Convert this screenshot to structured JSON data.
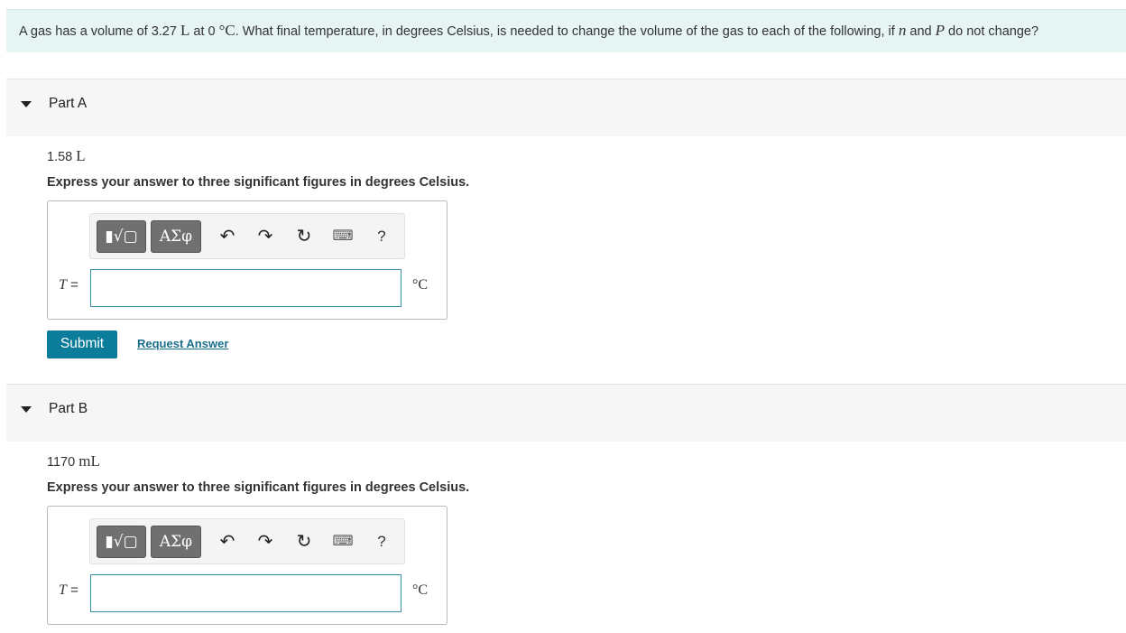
{
  "problem": {
    "text_1": "A gas has a volume of 3.27",
    "unit_1": "L",
    "text_2": "at 0",
    "unit_2": "°C",
    "text_3": ". What final temperature, in degrees Celsius, is needed to change the volume of the gas to each of the following, if",
    "var_n": "n",
    "text_4": "and",
    "var_P": "P",
    "text_5": "do not change?"
  },
  "parts": [
    {
      "title": "Part A",
      "given_value": "1.58",
      "given_unit": "L",
      "instruction": "Express your answer to three significant figures in degrees Celsius.",
      "var": "T",
      "eq": "=",
      "input_value": "",
      "unit": "°C",
      "submit_label": "Submit",
      "request_label": "Request Answer"
    },
    {
      "title": "Part B",
      "given_value": "1170",
      "given_unit": "mL",
      "instruction": "Express your answer to three significant figures in degrees Celsius.",
      "var": "T",
      "eq": "=",
      "input_value": "",
      "unit": "°C"
    }
  ],
  "toolbar": {
    "templates_icon": "templates-icon",
    "templates_label": "▮√▢",
    "greek_label": "ΑΣφ",
    "undo_icon": "undo-icon",
    "undo": "↶",
    "redo_icon": "redo-icon",
    "redo": "↷",
    "reset_icon": "reset-icon",
    "reset": "↻",
    "keyboard_icon": "keyboard-icon",
    "keyboard": "⌨",
    "help": "?"
  },
  "colors": {
    "problem_bg": "#e6f4f4",
    "part_header_bg": "#f6f6f6",
    "submit_bg": "#0b7c99",
    "link": "#1b6f8c",
    "input_border": "#3b8fa3"
  }
}
